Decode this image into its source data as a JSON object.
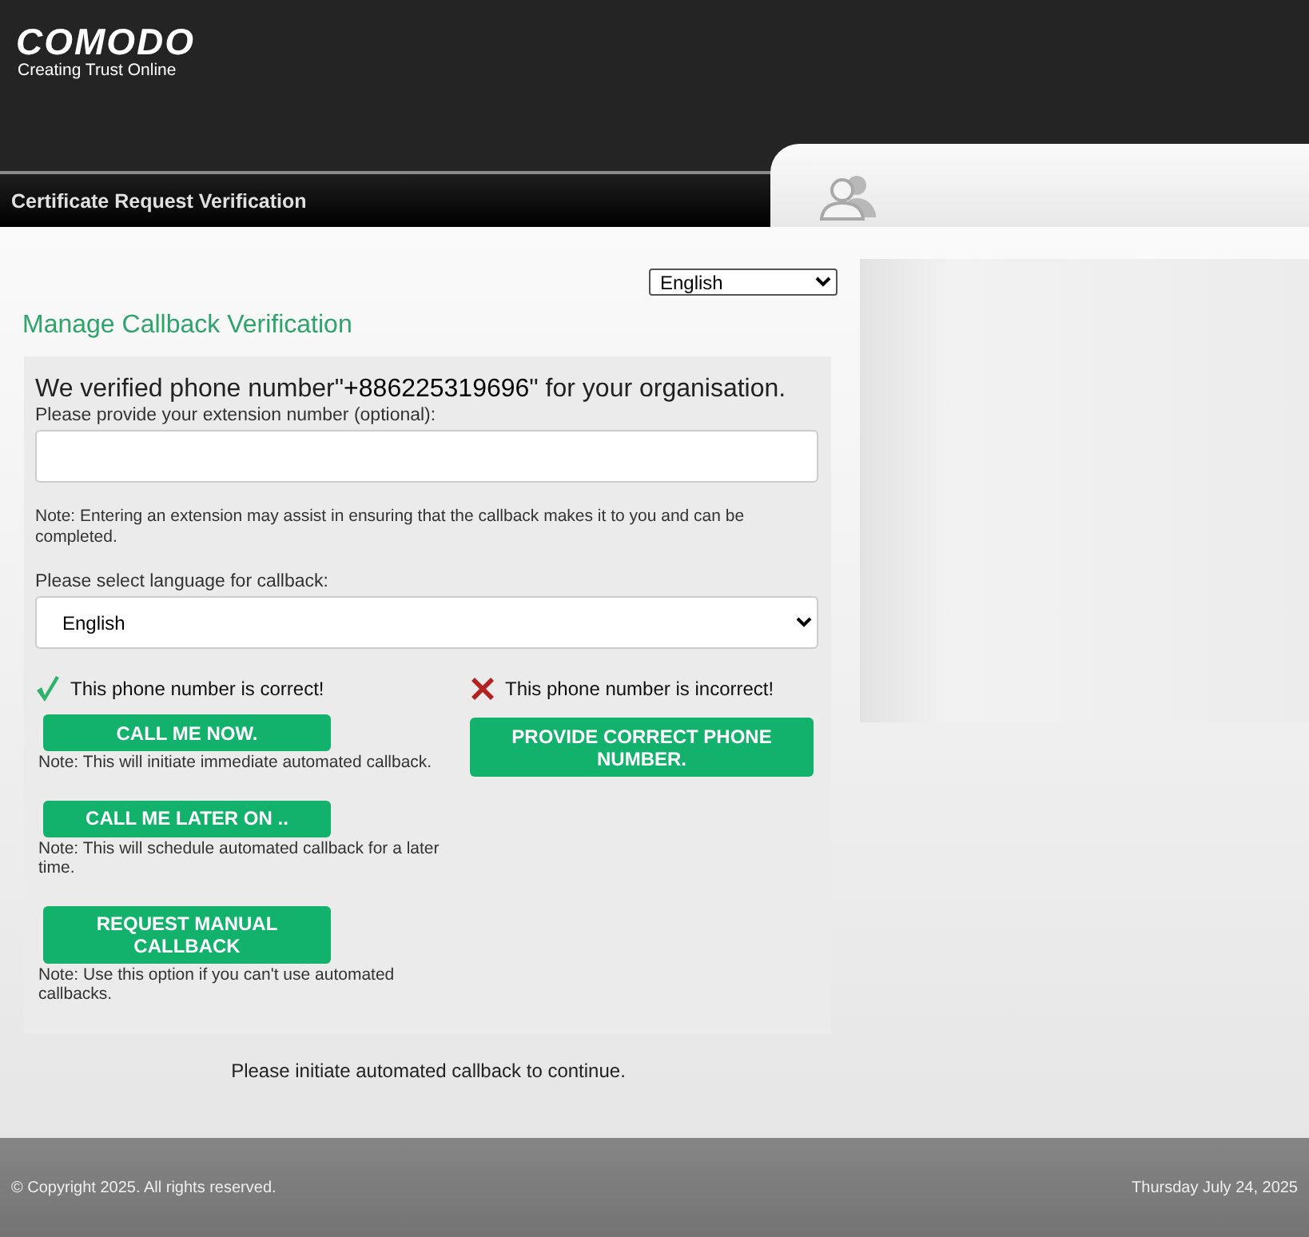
{
  "header": {
    "logo": "COMODO",
    "tagline": "Creating Trust Online",
    "page_title": "Certificate Request Verification"
  },
  "language_select": {
    "value": "English"
  },
  "section_title": "Manage Callback Verification",
  "verified_text": "We verified phone number\"**+886225319696**\" for your organisation.",
  "extension": {
    "label": "Please provide your extension number (optional):",
    "note": "Note: Entering an extension may assist in ensuring that the callback makes it to you and can be completed."
  },
  "callback_language": {
    "label": "Please select language for callback:",
    "value": "English"
  },
  "correct": {
    "label": "This phone number is correct!",
    "actions": [
      {
        "button": "CALL ME NOW.",
        "note": "Note: This will initiate immediate automated callback."
      },
      {
        "button": "CALL ME LATER ON ..",
        "note": "Note: This will schedule automated callback for a later time."
      },
      {
        "button": "REQUEST MANUAL CALLBACK",
        "note": "Note: Use this option if you can't use automated callbacks."
      }
    ]
  },
  "incorrect": {
    "label": "This phone number is incorrect!",
    "button": "PROVIDE CORRECT PHONE NUMBER."
  },
  "status_message": "Please initiate automated callback to continue.",
  "footer": {
    "copyright": "© Copyright 2025. All rights reserved.",
    "date": "Thursday July 24, 2025"
  }
}
